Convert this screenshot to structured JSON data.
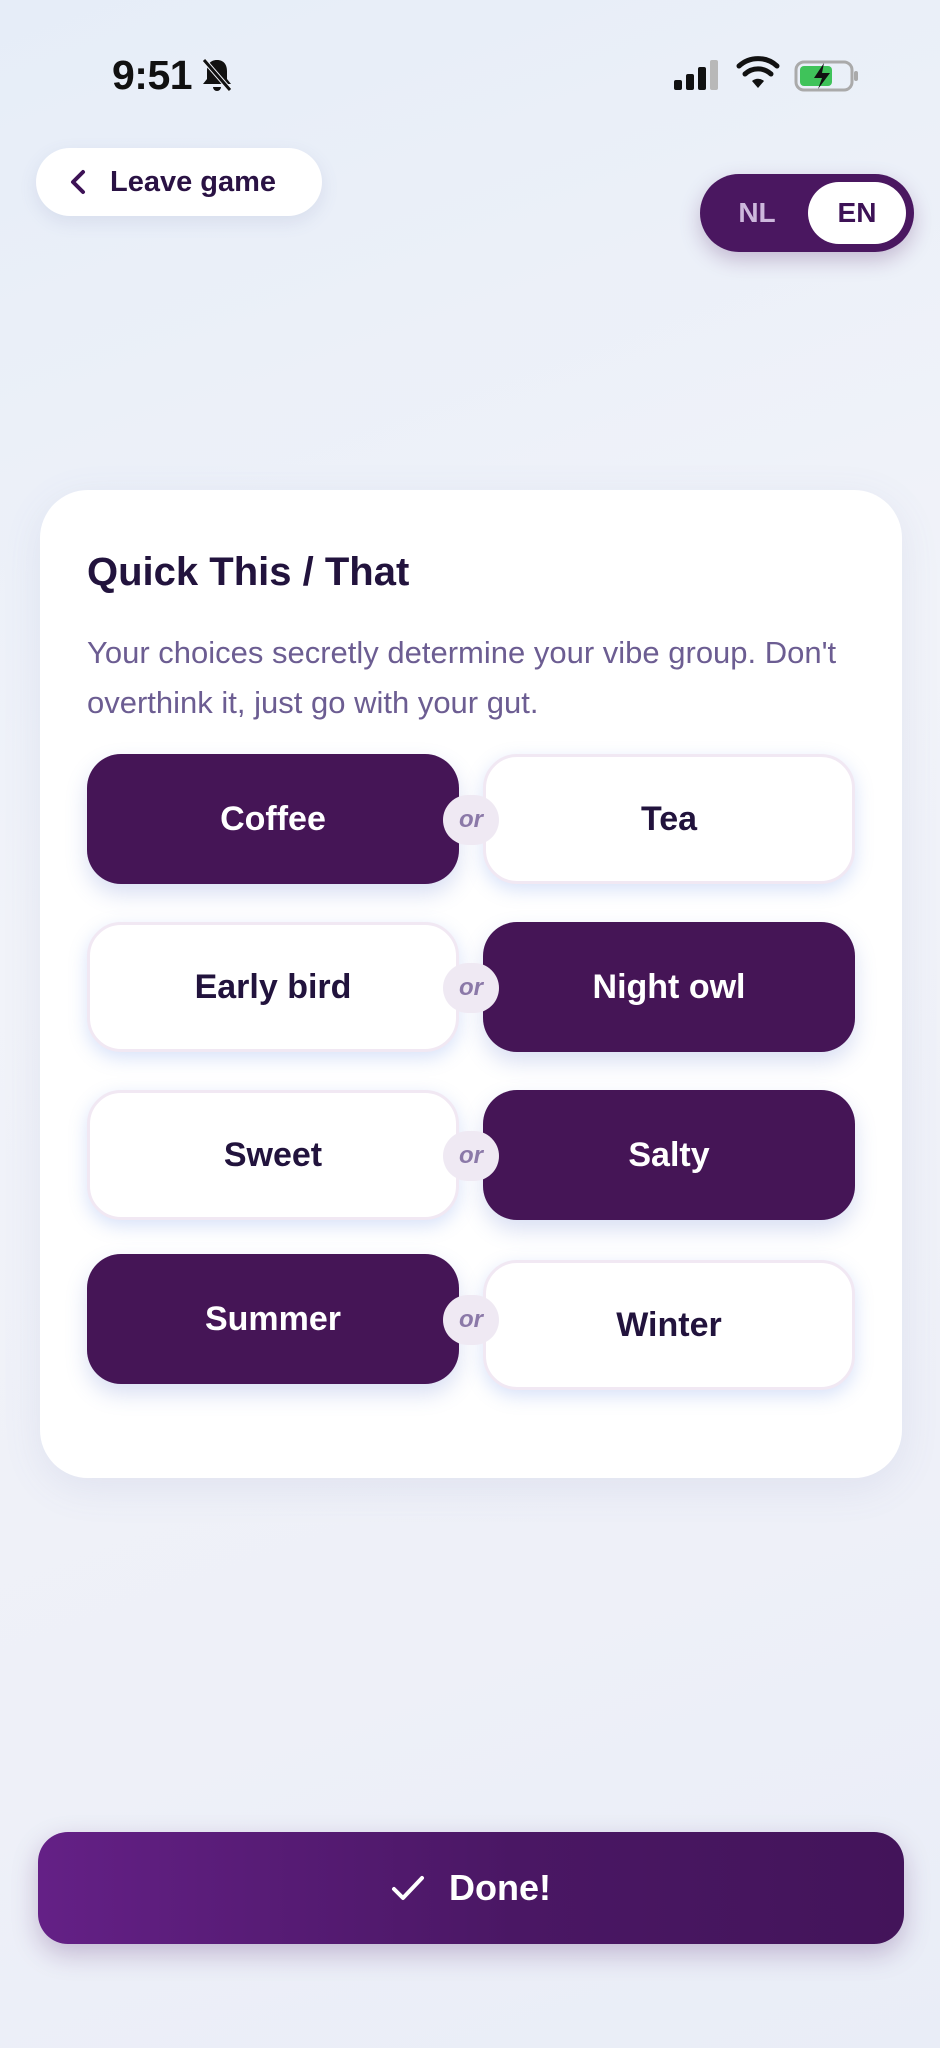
{
  "status_bar": {
    "time": "9:51",
    "icons": [
      "bell-muted-icon",
      "signal-icon",
      "wifi-icon",
      "battery-charging-icon"
    ]
  },
  "header": {
    "leave_label": "Leave game",
    "leave_icon": "chevron-left-icon",
    "language": {
      "options": [
        "NL",
        "EN"
      ],
      "selected": "EN"
    }
  },
  "card": {
    "title": "Quick This / That",
    "description": "Your choices secretly determine your vibe group. Don't overthink it, just go with your gut.",
    "separator": "or",
    "pairs": [
      {
        "left": "Coffee",
        "right": "Tea",
        "selected": "left"
      },
      {
        "left": "Early bird",
        "right": "Night owl",
        "selected": "right"
      },
      {
        "left": "Sweet",
        "right": "Salty",
        "selected": "right"
      },
      {
        "left": "Summer",
        "right": "Winter",
        "selected": "left"
      }
    ]
  },
  "footer": {
    "done_label": "Done!",
    "done_icon": "checkmark-icon"
  },
  "colors": {
    "primary": "#451556",
    "text_dark": "#22133d",
    "text_muted": "#6c5d92",
    "or_bg": "#efe9f3"
  }
}
